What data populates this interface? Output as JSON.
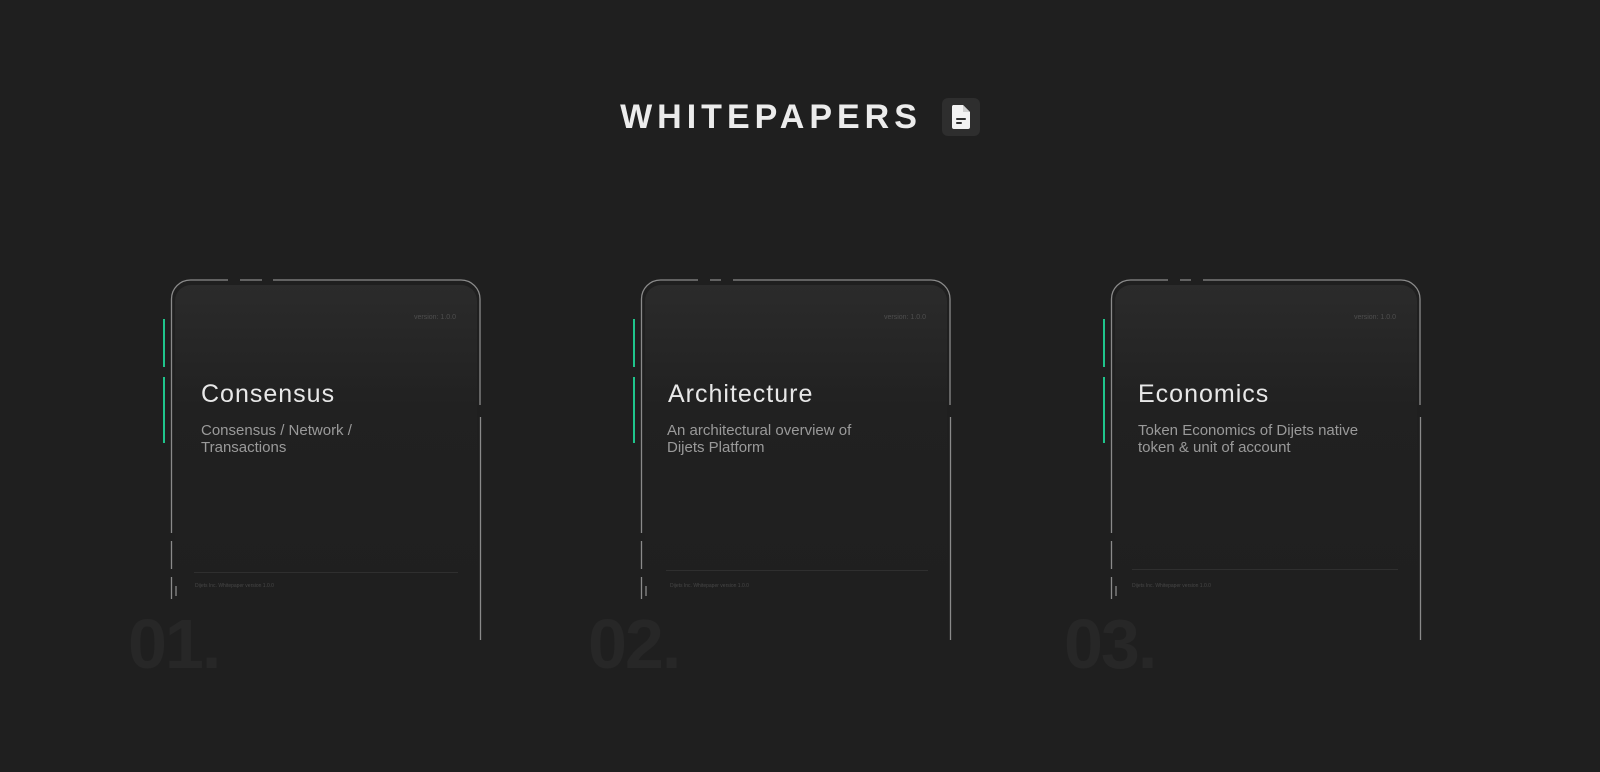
{
  "header": {
    "title": "WHITEPAPERS",
    "icon": "document-icon"
  },
  "cards": [
    {
      "version": "version: 1.0.0",
      "title": "Consensus",
      "description": "Consensus / Network / Transactions",
      "footer": "Dijets Inc. Whitepaper version 1.0.0",
      "number": "01."
    },
    {
      "version": "version: 1.0.0",
      "title": "Architecture",
      "description": "An architectural overview of Dijets Platform",
      "footer": "Dijets Inc. Whitepaper version 1.0.0",
      "number": "02."
    },
    {
      "version": "version: 1.0.0",
      "title": "Economics",
      "description": "Token Economics of Dijets native token & unit of account",
      "footer": "Dijets Inc. Whitepaper version 1.0.0",
      "number": "03."
    }
  ],
  "colors": {
    "background": "#1f1f1f",
    "accent": "#1fc48b",
    "frame": "#8a8a8a",
    "title": "#e8e8e8",
    "description": "#9a9a9a"
  }
}
